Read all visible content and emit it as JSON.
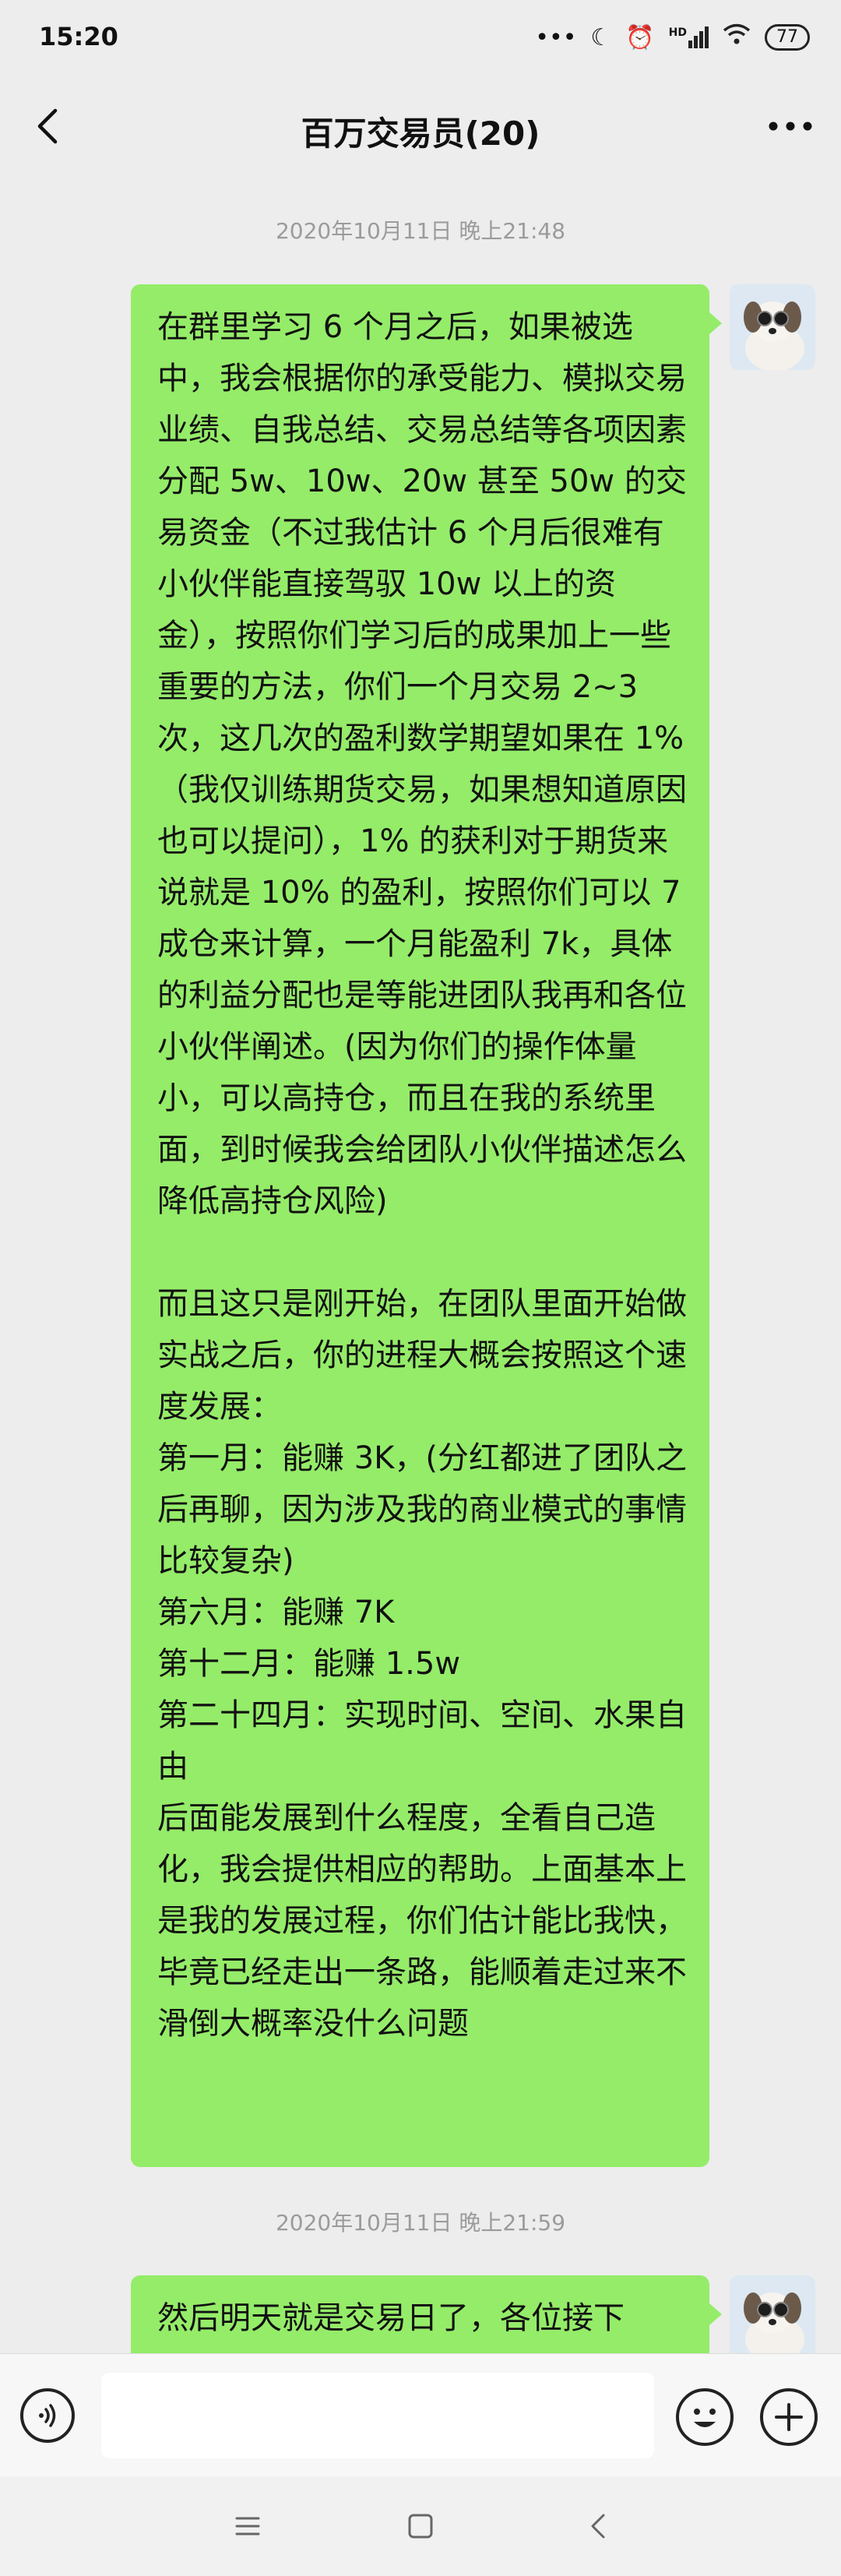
{
  "status_bar": {
    "time": "15:20",
    "icons": [
      "dots-icon",
      "moon-icon",
      "alarm-icon",
      "signal-icon",
      "wifi-icon"
    ],
    "signal_label": "HD",
    "battery": "77"
  },
  "header": {
    "title": "百万交易员(20)",
    "back_icon": "chevron-left-icon",
    "more_icon": "more-icon"
  },
  "messages": [
    {
      "timestamp": "2020年10月11日 晚上21:48",
      "text": "在群里学习 6 个月之后，如果被选中，我会根据你的承受能力、模拟交易业绩、自我总结、交易总结等各项因素分配 5w、10w、20w 甚至 50w 的交易资金（不过我估计 6 个月后很难有小伙伴能直接驾驭 10w 以上的资金），按照你们学习后的成果加上一些重要的方法，你们一个月交易 2~3 次，这几次的盈利数学期望如果在 1%（我仅训练期货交易，如果想知道原因也可以提问），1% 的获利对于期货来说就是 10% 的盈利，按照你们可以 7 成仓来计算，一个月能盈利 7k，具体的利益分配也是等能进团队我再和各位小伙伴阐述。(因为你们的操作体量小，可以高持仓，而且在我的系统里面，到时候我会给团队小伙伴描述怎么降低高持仓风险)\n\n而且这只是刚开始，在团队里面开始做实战之后，你的进程大概会按照这个速度发展：\n第一月：能赚 3K，(分红都进了团队之后再聊，因为涉及我的商业模式的事情比较复杂)\n第六月：能赚 7K\n第十二月：能赚 1.5w\n第二十四月：实现时间、空间、水果自由\n后面能发展到什么程度，全看自己造化，我会提供相应的帮助。上面基本上是我的发展过程，你们估计能比我快，毕竟已经走出一条路，能顺着走过来不滑倒大概率没什么问题"
    },
    {
      "timestamp": "2020年10月11日 晚上21:59",
      "text": "然后明天就是交易日了，各位接下"
    }
  ],
  "input_bar": {
    "placeholder": "",
    "voice_icon": "voice-icon",
    "emoji_icon": "emoji-icon",
    "add_icon": "plus-icon"
  },
  "system_nav": {
    "menu_icon": "menu-icon",
    "home_icon": "home-icon",
    "back_icon": "back-icon"
  },
  "colors": {
    "background": "#ededed",
    "bubble": "#95ec69",
    "timestamp": "#9b9b9b"
  }
}
